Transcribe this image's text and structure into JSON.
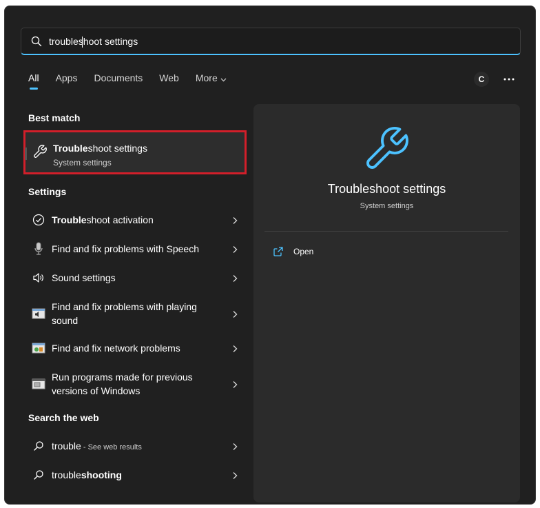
{
  "search": {
    "typed": "troubleshoot settings"
  },
  "tabs": [
    {
      "label": "All"
    },
    {
      "label": "Apps"
    },
    {
      "label": "Documents"
    },
    {
      "label": "Web"
    },
    {
      "label": "More"
    }
  ],
  "header": {
    "avatar_letter": "C"
  },
  "left": {
    "best_match_title": "Best match",
    "best_match": {
      "title_bold": "Trouble",
      "title_rest": "shoot settings",
      "subtitle": "System settings"
    },
    "settings_title": "Settings",
    "settings_items": [
      {
        "bold": "Trouble",
        "text": "shoot activation",
        "icon": "check-circle-icon"
      },
      {
        "bold": "",
        "text": "Find and fix problems with Speech",
        "icon": "microphone-icon"
      },
      {
        "bold": "",
        "text": "Sound settings",
        "icon": "speaker-icon"
      },
      {
        "bold": "",
        "text": "Find and fix problems with playing sound",
        "icon": "sound-troubleshooter-icon"
      },
      {
        "bold": "",
        "text": "Find and fix network problems",
        "icon": "network-troubleshooter-icon"
      },
      {
        "bold": "",
        "text": "Run programs made for previous versions of Windows",
        "icon": "compatibility-icon"
      }
    ],
    "web_title": "Search the web",
    "web_items": [
      {
        "text": "trouble",
        "suffix": " - See web results",
        "icon": "search-icon"
      },
      {
        "text": "trouble",
        "bold": "shooting",
        "icon": "search-icon"
      }
    ]
  },
  "preview": {
    "title": "Troubleshoot settings",
    "subtitle": "System settings",
    "action_open": "Open"
  },
  "colors": {
    "accent": "#4cc2ff",
    "highlight_border": "#d21f2a",
    "panel": "#202020",
    "preview": "#2b2b2b"
  }
}
